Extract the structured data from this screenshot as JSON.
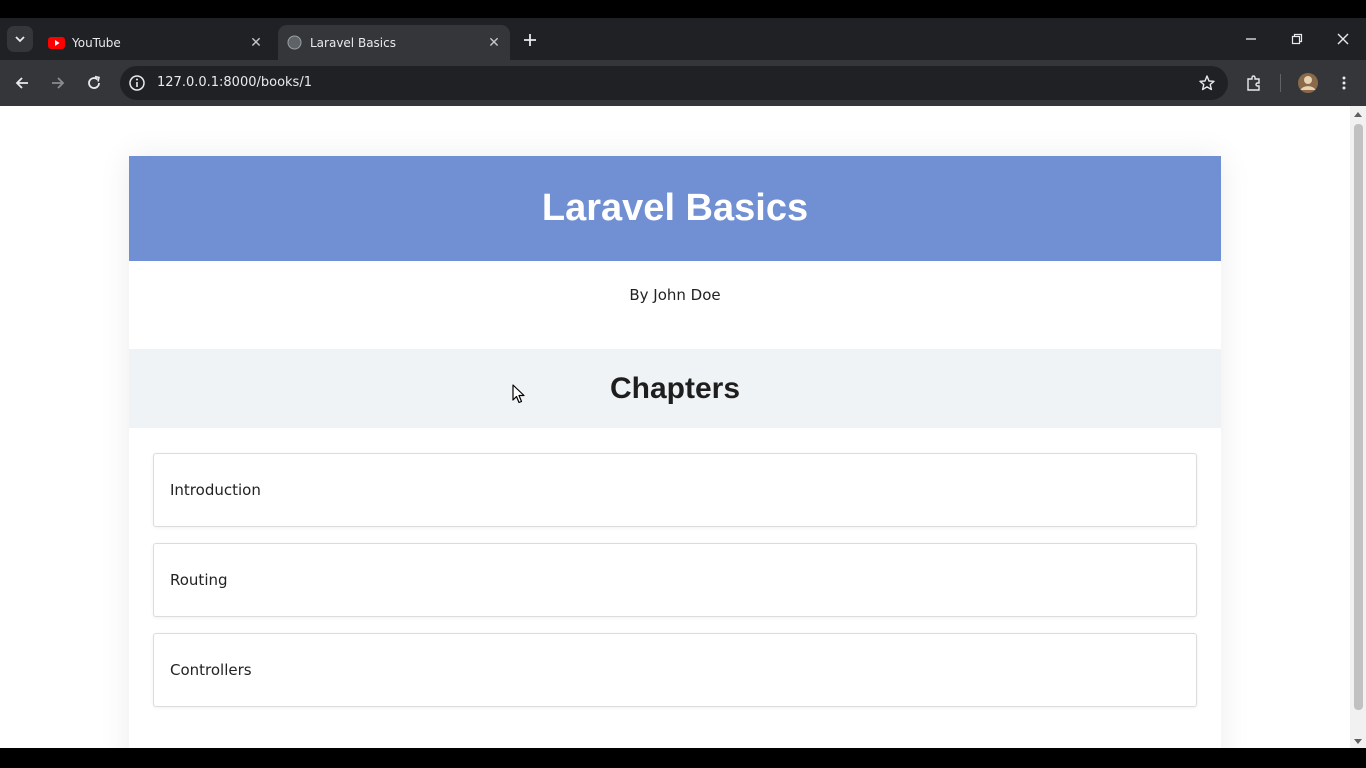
{
  "browser": {
    "tabs": [
      {
        "title": "YouTube",
        "active": false,
        "favicon": "youtube-icon"
      },
      {
        "title": "Laravel Basics",
        "active": true,
        "favicon": "globe-icon"
      }
    ],
    "url": "127.0.0.1:8000/books/1"
  },
  "page": {
    "book_title": "Laravel Basics",
    "author_line": "By John Doe",
    "chapters_heading": "Chapters",
    "chapters": [
      {
        "title": "Introduction"
      },
      {
        "title": "Routing"
      },
      {
        "title": "Controllers"
      }
    ]
  },
  "colors": {
    "header_blue": "#7190d4",
    "band_gray": "#f0f3f5",
    "chrome_dark": "#202124",
    "chrome_toolbar": "#35363a"
  }
}
